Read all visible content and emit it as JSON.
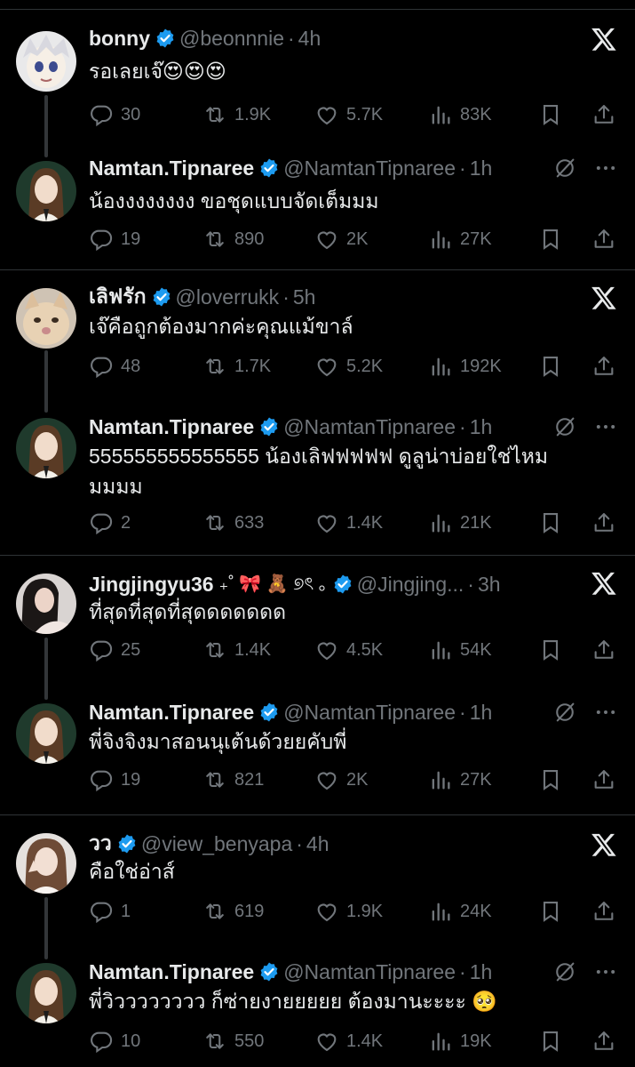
{
  "threads": [
    {
      "reply": {
        "name": "bonny",
        "handle": "@beonnnie",
        "time": "4h",
        "text": "รอเลยเจ๊😍😍😍",
        "stats": {
          "replies": "30",
          "reposts": "1.9K",
          "likes": "5.7K",
          "views": "83K"
        }
      },
      "response": {
        "name": "Namtan.Tipnaree",
        "handle": "@NamtanTipnaree",
        "time": "1h",
        "text": "น้องงงงงงงง ขอชุดแบบจัดเต็มมม",
        "stats": {
          "replies": "19",
          "reposts": "890",
          "likes": "2K",
          "views": "27K"
        }
      }
    },
    {
      "reply": {
        "name": "เลิฟรัก",
        "handle": "@loverrukk",
        "time": "5h",
        "text": "เจ๊คือถูกต้องมากค่ะคุณแม้ขาล์",
        "stats": {
          "replies": "48",
          "reposts": "1.7K",
          "likes": "5.2K",
          "views": "192K"
        }
      },
      "response": {
        "name": "Namtan.Tipnaree",
        "handle": "@NamtanTipnaree",
        "time": "1h",
        "text": "555555555555555 น้องเลิฟฟฟฟฟ ดูลูน่าบ่อยใช่ไหมมมมม",
        "stats": {
          "replies": "2",
          "reposts": "633",
          "likes": "1.4K",
          "views": "21K"
        }
      }
    },
    {
      "reply": {
        "name": "Jingjingyu36",
        "name_emoji": "₊˚ 🎀 🧸 ୭ৎ ｡",
        "handle": "@Jingjing...",
        "time": "3h",
        "text": "ที่สุดที่สุดที่สุดดดดดดด",
        "stats": {
          "replies": "25",
          "reposts": "1.4K",
          "likes": "4.5K",
          "views": "54K"
        }
      },
      "response": {
        "name": "Namtan.Tipnaree",
        "handle": "@NamtanTipnaree",
        "time": "1h",
        "text": "พี่จิงจิงมาสอนนุเต้นด้วยยคับพี่",
        "stats": {
          "replies": "19",
          "reposts": "821",
          "likes": "2K",
          "views": "27K"
        }
      }
    },
    {
      "reply": {
        "name": "วว",
        "handle": "@view_benyapa",
        "time": "4h",
        "text": "คือใช่อ่าส์",
        "stats": {
          "replies": "1",
          "reposts": "619",
          "likes": "1.9K",
          "views": "24K"
        }
      },
      "response": {
        "name": "Namtan.Tipnaree",
        "handle": "@NamtanTipnaree",
        "time": "1h",
        "text": "พี่วิวววววววว ก็ซ่ายงายยยยย ต้องมานะะะะ 🥺",
        "stats": {
          "replies": "10",
          "reposts": "550",
          "likes": "1.4K",
          "views": "19K"
        }
      }
    }
  ],
  "colors": {
    "background": "#000000",
    "text": "#e7e9ea",
    "muted": "#71767b",
    "verified": "#1d9bf0",
    "divider": "#2f3336"
  },
  "icons": [
    "reply-icon",
    "repost-icon",
    "like-icon",
    "views-icon",
    "bookmark-icon",
    "share-icon",
    "x-logo-icon",
    "verified-badge-icon",
    "no-image-icon",
    "more-icon"
  ]
}
